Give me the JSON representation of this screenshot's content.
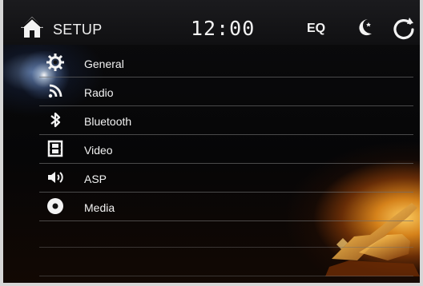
{
  "topbar": {
    "home_icon": "home-icon",
    "title": "SETUP",
    "clock": "12:00",
    "eq_label": "EQ",
    "moon_icon": "moon-icon",
    "back_icon": "back-icon"
  },
  "menu": {
    "items": [
      {
        "label": "General",
        "icon": "gear-icon"
      },
      {
        "label": "Radio",
        "icon": "radio-wave-icon"
      },
      {
        "label": "Bluetooth",
        "icon": "bluetooth-icon"
      },
      {
        "label": "Video",
        "icon": "film-icon"
      },
      {
        "label": "ASP",
        "icon": "speaker-icon"
      },
      {
        "label": "Media",
        "icon": "disc-icon"
      }
    ]
  },
  "colors": {
    "text": "#f3f3f3",
    "frame": "#d6d6d6",
    "glow": "#f2a533"
  }
}
